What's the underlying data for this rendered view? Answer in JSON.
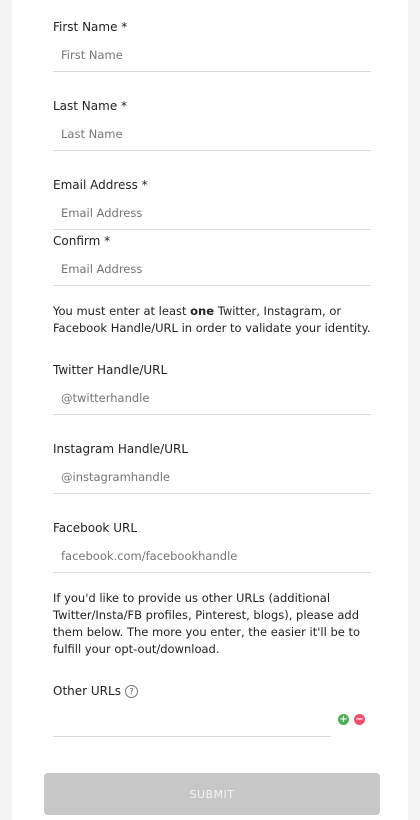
{
  "form": {
    "first_name": {
      "label": "First Name *",
      "placeholder": "First Name",
      "value": ""
    },
    "last_name": {
      "label": "Last Name *",
      "placeholder": "Last Name",
      "value": ""
    },
    "email": {
      "label": "Email Address *",
      "placeholder": "Email Address",
      "value": ""
    },
    "confirm": {
      "label": "Confirm *",
      "placeholder": "Email Address",
      "value": ""
    },
    "identity_note": {
      "before": "You must enter at least ",
      "bold": "one",
      "after": " Twitter, Instagram, or Facebook Handle/URL in order to validate your identity."
    },
    "twitter": {
      "label": "Twitter Handle/URL",
      "placeholder": "@twitterhandle",
      "value": ""
    },
    "instagram": {
      "label": "Instagram Handle/URL",
      "placeholder": "@instagramhandle",
      "value": ""
    },
    "facebook": {
      "label": "Facebook URL",
      "placeholder": "facebook.com/facebookhandle",
      "value": ""
    },
    "other_urls_note": "If you'd like to provide us other URLs (additional Twitter/Insta/FB profiles, Pinterest, blogs), please add them below. The more you enter, the easier it'll be to fulfill your opt-out/download.",
    "other_urls": {
      "label": "Other URLs",
      "help_icon": "?",
      "value": "",
      "add_symbol": "+",
      "remove_symbol": "−"
    },
    "submit_label": "SUBMIT"
  },
  "colors": {
    "background": "#f3f3f3",
    "card": "#ffffff",
    "divider": "#d9d9d9",
    "add_button": "#4caf50",
    "remove_button": "#f0506e",
    "submit_disabled": "#c7c7c7"
  }
}
